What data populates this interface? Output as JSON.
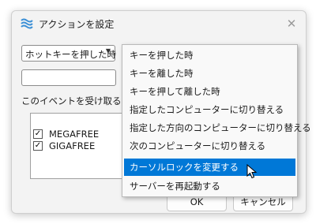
{
  "window": {
    "title": "アクションを設定",
    "close_glyph": "✕"
  },
  "trigger_select": {
    "value": "ホットキーを押した時",
    "arrow_glyph": "▼"
  },
  "hotkey_field": {
    "value": ""
  },
  "section": {
    "label": "このイベントを受け取るコンピューター"
  },
  "computers": [
    {
      "name": "MEGAFREE",
      "checked": true,
      "check_glyph": "✓"
    },
    {
      "name": "GIGAFREE",
      "checked": true,
      "check_glyph": "✓"
    }
  ],
  "buttons": {
    "ok": "OK",
    "cancel": "キャンセル"
  },
  "action_menu": {
    "items": [
      "キーを押した時",
      "キーを離した時",
      "キーを押して離した時",
      "指定したコンピューターに切り替える",
      "指定した方向のコンピューターに切り替える",
      "次のコンピューターに切り替える",
      "カーソルロックを変更する",
      "サーバーを再起動する"
    ],
    "highlighted_index": 6
  },
  "colors": {
    "highlight": "#0078d7",
    "app_icon": "#3b8fd6"
  },
  "icons": {
    "app": "waves-icon",
    "close": "close-icon",
    "cursor": "mouse-pointer-icon"
  }
}
